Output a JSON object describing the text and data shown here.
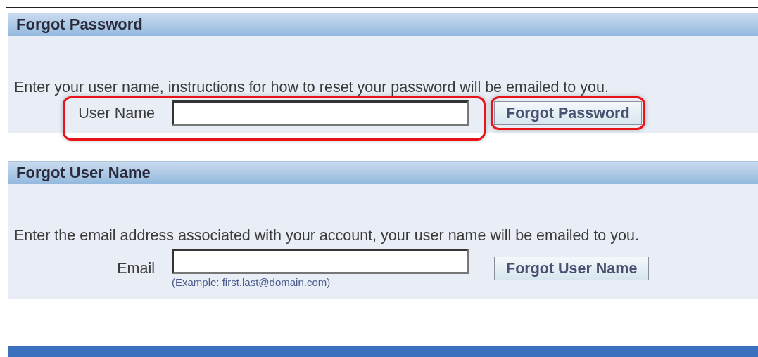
{
  "sections": [
    {
      "title": "Forgot Password",
      "description": "Enter your user name, instructions for how to reset your password will be emailed to you.",
      "field_label": "User Name",
      "button": "Forgot Password",
      "field_highlighted": true,
      "button_highlighted": true
    },
    {
      "title": "Forgot User Name",
      "description": "Enter the email address associated with your account, your user name will be emailed to you.",
      "field_label": "Email",
      "hint": "(Example: first.last@domain.com)",
      "button": "Forgot User Name",
      "field_highlighted": false,
      "button_highlighted": false
    }
  ]
}
